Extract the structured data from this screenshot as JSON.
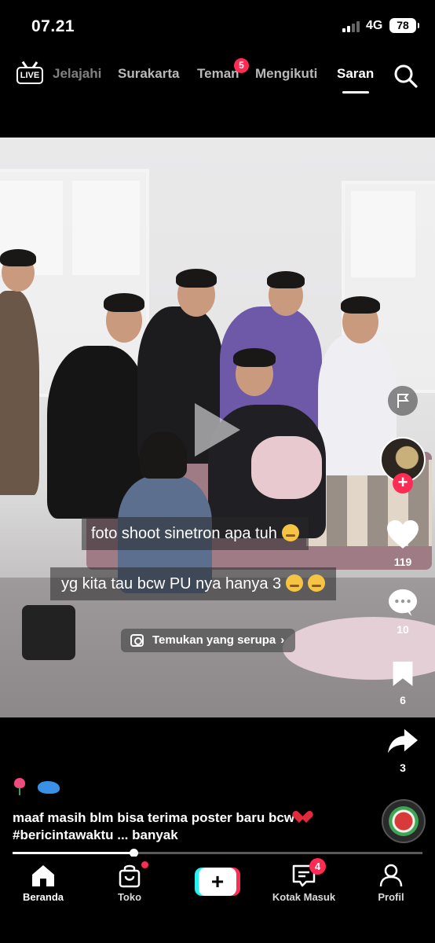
{
  "status_bar": {
    "time": "07.21",
    "network": "4G",
    "battery": "78"
  },
  "top_nav": {
    "live_label": "LIVE",
    "tabs": [
      {
        "label": "Jelajahi"
      },
      {
        "label": "Surakarta"
      },
      {
        "label": "Teman",
        "badge": "5"
      },
      {
        "label": "Mengikuti"
      },
      {
        "label": "Saran",
        "active": true
      }
    ]
  },
  "video": {
    "similar_pill": "Temukan yang serupa",
    "comments": [
      {
        "text": "foto shoot sinetron apa tuh"
      },
      {
        "text": "yg kita tau bcw PU nya hanya 3"
      }
    ]
  },
  "right_rail": {
    "likes": "119",
    "comments": "10",
    "bookmarks": "6",
    "shares": "3"
  },
  "caption": {
    "line": "maaf masih blm bisa terima poster baru bcw",
    "hashtag": "#bericintawaktu",
    "more": "... banyak"
  },
  "progress": {
    "fraction": 0.295
  },
  "bottom_nav": {
    "items": [
      {
        "label": "Beranda",
        "active": true
      },
      {
        "label": "Toko"
      },
      {
        "label": "Kotak Masuk",
        "badge": "4"
      },
      {
        "label": "Profil"
      }
    ]
  },
  "colors": {
    "accent": "#fe2c55",
    "cyan": "#25f4ee"
  }
}
